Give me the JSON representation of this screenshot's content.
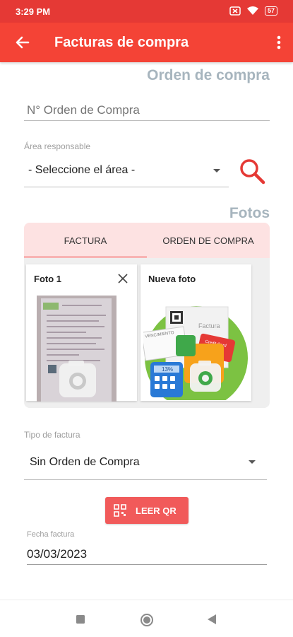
{
  "status_bar": {
    "time": "3:29 PM",
    "battery": "57"
  },
  "app_bar": {
    "title": "Facturas de compra"
  },
  "order_section": {
    "title": "Orden de compra",
    "order_number_placeholder": "N° Orden de Compra",
    "area_label": "Área responsable",
    "area_value": "- Seleccione el área -"
  },
  "photos_section": {
    "title": "Fotos",
    "tabs": [
      "FACTURA",
      "ORDEN DE COMPRA"
    ],
    "active_tab": "FACTURA",
    "tiles": [
      {
        "label": "Foto 1"
      },
      {
        "label": "Nueva foto",
        "illustration_texts": [
          "VENCIMIENTO",
          "Factura",
          "Credit Card",
          "13%"
        ]
      }
    ]
  },
  "invoice_type": {
    "label": "Tipo de factura",
    "value": "Sin Orden de Compra"
  },
  "qr_button": {
    "label": "LEER QR"
  },
  "invoice_date": {
    "label": "Fecha factura",
    "value": "03/03/2023"
  },
  "colors": {
    "primary": "#f44336",
    "status_bar": "#e53935",
    "section_title": "#a7b5be",
    "tab_bg": "#fde2e2",
    "button": "#f15a5a"
  }
}
